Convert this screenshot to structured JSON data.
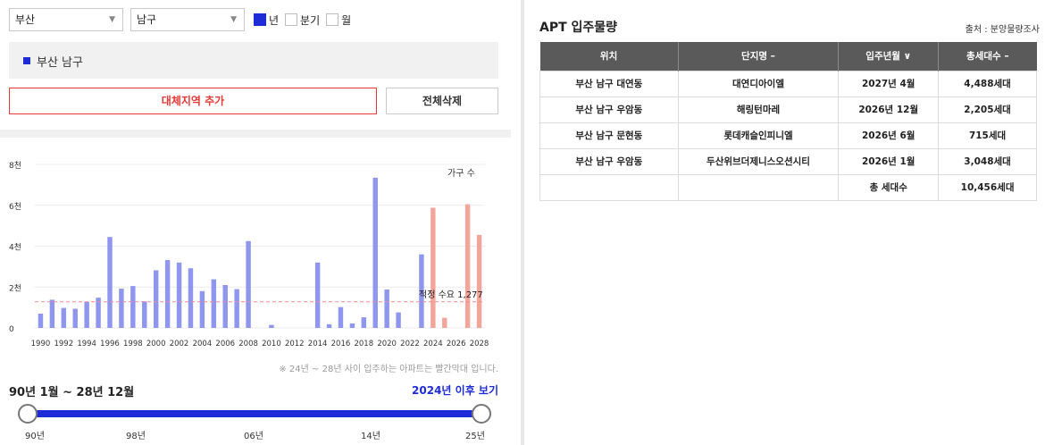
{
  "filters": {
    "city": "부산",
    "district": "남구",
    "period_options": [
      {
        "label": "년",
        "checked": true
      },
      {
        "label": "분기",
        "checked": false
      },
      {
        "label": "월",
        "checked": false
      }
    ]
  },
  "selected_region": "부산 남구",
  "buttons": {
    "add_region": "대체지역 추가",
    "delete_all": "전체삭제"
  },
  "chart_data": {
    "type": "bar",
    "legend_label": "가구 수",
    "y_ticks": [
      "0",
      "2천",
      "4천",
      "6천",
      "8천"
    ],
    "ylim": [
      0,
      8000
    ],
    "x_tick_labels": [
      "1990",
      "1992",
      "1994",
      "1996",
      "1998",
      "2000",
      "2002",
      "2004",
      "2006",
      "2008",
      "2010",
      "2012",
      "2014",
      "2016",
      "2018",
      "2020",
      "2022",
      "2024",
      "2026",
      "2028"
    ],
    "years": [
      1990,
      1991,
      1992,
      1993,
      1994,
      1995,
      1996,
      1997,
      1998,
      1999,
      2000,
      2001,
      2002,
      2003,
      2004,
      2005,
      2006,
      2007,
      2008,
      2009,
      2010,
      2011,
      2012,
      2013,
      2014,
      2015,
      2016,
      2017,
      2018,
      2019,
      2020,
      2021,
      2022,
      2023,
      2024,
      2025,
      2026,
      2027,
      2028
    ],
    "values": [
      700,
      1380,
      980,
      940,
      1280,
      1480,
      4450,
      1920,
      2050,
      1300,
      2820,
      3320,
      3200,
      2920,
      1800,
      2380,
      2100,
      1900,
      4250,
      0,
      150,
      0,
      0,
      0,
      3200,
      180,
      1020,
      220,
      520,
      7350,
      1880,
      760,
      0,
      3600,
      5880,
      500,
      0,
      6050,
      4550
    ],
    "highlight_from_year": 2024,
    "bar_color": "#8e96ee",
    "highlight_color": "#f3a49b",
    "reference_line": {
      "label": "적정 수요 1,277",
      "value": 1277,
      "color": "#f28b8b"
    }
  },
  "chart_note": "※ 24년 ~ 28년 사이 입주하는 아파트는 빨간막대 입니다.",
  "range": {
    "label": "90년 1월 ~ 28년 12월",
    "link": "2024년 이후 보기",
    "ticks": [
      "90년",
      "98년",
      "06년",
      "14년",
      "25년"
    ]
  },
  "apt": {
    "title": "APT 입주물량",
    "source": "출처 : 분양물량조사",
    "columns": [
      "위치",
      "단지명 –",
      "입주년월 ∨",
      "총세대수 –"
    ],
    "rows": [
      [
        "부산 남구 대연동",
        "대연디아이엘",
        "2027년 4월",
        "4,488세대"
      ],
      [
        "부산 남구 우암동",
        "해링턴마레",
        "2026년 12월",
        "2,205세대"
      ],
      [
        "부산 남구 문현동",
        "롯데캐슬인피니엘",
        "2026년 6월",
        "715세대"
      ],
      [
        "부산 남구 우암동",
        "두산위브더제니스오션시티",
        "2026년 1월",
        "3,048세대"
      ]
    ],
    "total_label": "총 세대수",
    "total_value": "10,456세대"
  }
}
